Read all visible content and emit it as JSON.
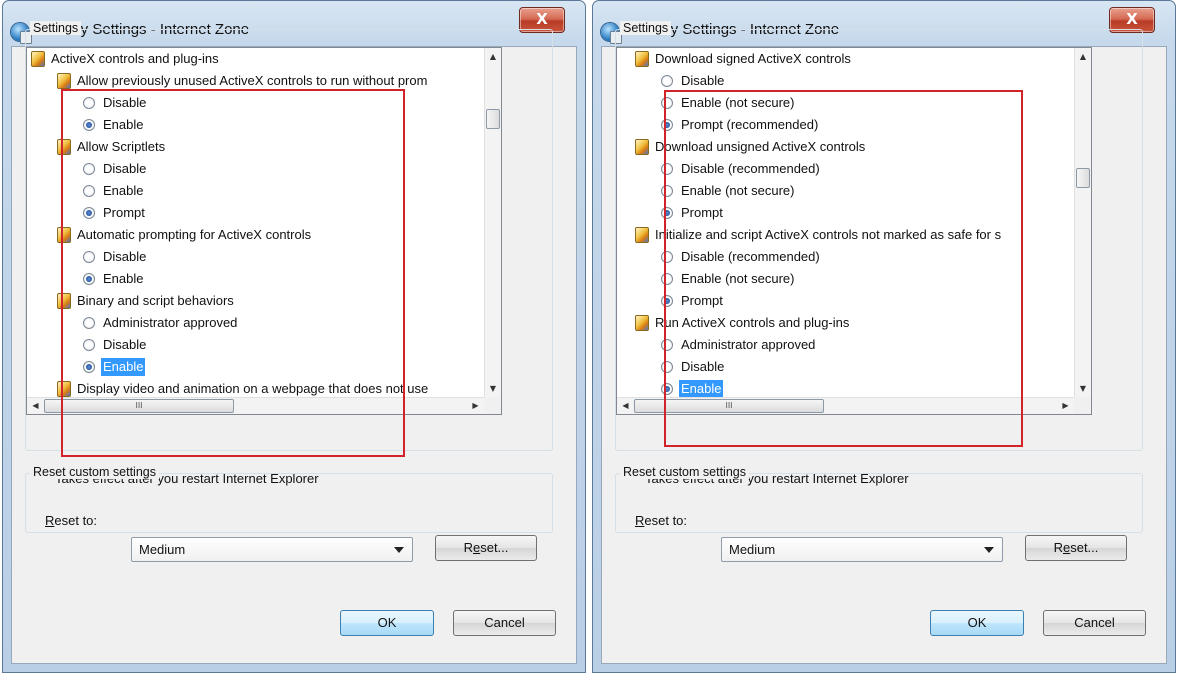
{
  "dialogs": [
    {
      "title": "Security Settings - Internet Zone",
      "close_label": "X",
      "settings_group_label": "Settings",
      "rows": [
        {
          "kind": "category",
          "text": "ActiveX controls and plug-ins"
        },
        {
          "kind": "setting",
          "text": "Allow previously unused ActiveX controls to run without prom"
        },
        {
          "kind": "option",
          "text": "Disable",
          "selected": false
        },
        {
          "kind": "option",
          "text": "Enable",
          "selected": true
        },
        {
          "kind": "setting",
          "text": "Allow Scriptlets"
        },
        {
          "kind": "option",
          "text": "Disable",
          "selected": false
        },
        {
          "kind": "option",
          "text": "Enable",
          "selected": false
        },
        {
          "kind": "option",
          "text": "Prompt",
          "selected": true
        },
        {
          "kind": "setting",
          "text": "Automatic prompting for ActiveX controls"
        },
        {
          "kind": "option",
          "text": "Disable",
          "selected": false
        },
        {
          "kind": "option",
          "text": "Enable",
          "selected": true
        },
        {
          "kind": "setting",
          "text": "Binary and script behaviors"
        },
        {
          "kind": "option",
          "text": "Administrator approved",
          "selected": false
        },
        {
          "kind": "option",
          "text": "Disable",
          "selected": false
        },
        {
          "kind": "option",
          "text": "Enable",
          "selected": true,
          "focused": true
        },
        {
          "kind": "setting",
          "text": "Display video and animation on a webpage that does not use"
        }
      ],
      "scroll_position": 0.15,
      "hscroll_thumb_label": "III",
      "note": "*Takes effect after you restart Internet Explorer",
      "reset_group_label": "Reset custom settings",
      "reset_to_label_pre": "R",
      "reset_to_label_post": "eset to:",
      "reset_level": "Medium",
      "reset_button_pre": "R",
      "reset_button_u": "e",
      "reset_button_post": "set...",
      "ok_label": "OK",
      "cancel_label": "Cancel"
    },
    {
      "title": "Security Settings - Internet Zone",
      "close_label": "X",
      "settings_group_label": "Settings",
      "rows": [
        {
          "kind": "setting",
          "text": "Download signed ActiveX controls"
        },
        {
          "kind": "option",
          "text": "Disable",
          "selected": false
        },
        {
          "kind": "option",
          "text": "Enable (not secure)",
          "selected": false
        },
        {
          "kind": "option",
          "text": "Prompt (recommended)",
          "selected": true
        },
        {
          "kind": "setting",
          "text": "Download unsigned ActiveX controls"
        },
        {
          "kind": "option",
          "text": "Disable (recommended)",
          "selected": false
        },
        {
          "kind": "option",
          "text": "Enable (not secure)",
          "selected": false
        },
        {
          "kind": "option",
          "text": "Prompt",
          "selected": true
        },
        {
          "kind": "setting",
          "text": "Initialize and script ActiveX controls not marked as safe for s"
        },
        {
          "kind": "option",
          "text": "Disable (recommended)",
          "selected": false
        },
        {
          "kind": "option",
          "text": "Enable (not secure)",
          "selected": false
        },
        {
          "kind": "option",
          "text": "Prompt",
          "selected": true
        },
        {
          "kind": "setting",
          "text": "Run ActiveX controls and plug-ins"
        },
        {
          "kind": "option",
          "text": "Administrator approved",
          "selected": false
        },
        {
          "kind": "option",
          "text": "Disable",
          "selected": false
        },
        {
          "kind": "option",
          "text": "Enable",
          "selected": true,
          "focused": true
        }
      ],
      "scroll_position": 0.35,
      "hscroll_thumb_label": "III",
      "note": "*Takes effect after you restart Internet Explorer",
      "reset_group_label": "Reset custom settings",
      "reset_to_label_pre": "R",
      "reset_to_label_post": "eset to:",
      "reset_level": "Medium",
      "reset_button_pre": "R",
      "reset_button_u": "e",
      "reset_button_post": "set...",
      "ok_label": "OK",
      "cancel_label": "Cancel"
    }
  ],
  "colors": {
    "highlight_box": "#d2232a",
    "selection": "#3399ff"
  }
}
